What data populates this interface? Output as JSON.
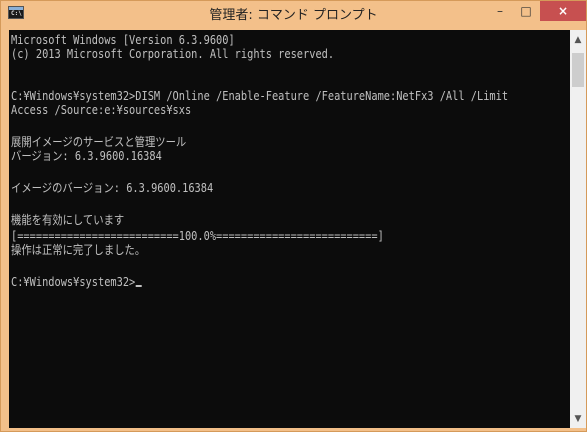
{
  "window": {
    "title": "管理者: コマンド プロンプト",
    "icon_label": "C:\\",
    "controls": {
      "minimize": "–",
      "maximize": "□",
      "close": "×"
    }
  },
  "console": {
    "lines": [
      "Microsoft Windows [Version 6.3.9600]",
      "(c) 2013 Microsoft Corporation. All rights reserved.",
      "",
      "C:¥Windows¥system32>DISM /Online /Enable-Feature /FeatureName:NetFx3 /All /Limit",
      "Access /Source:e:¥sources¥sxs",
      "",
      "展開イメージのサービスと管理ツール",
      "バージョン: 6.3.9600.16384",
      "",
      "イメージのバージョン: 6.3.9600.16384",
      "",
      "機能を有効にしています",
      "[==========================100.0%==========================]",
      "操作は正常に完了しました。",
      "",
      "C:¥Windows¥system32>"
    ]
  },
  "scrollbar": {
    "up_arrow": "▲",
    "down_arrow": "▼"
  },
  "colors": {
    "titlebar": "#f3c08a",
    "console_bg": "#0c0c0c",
    "console_fg": "#c0c0c0",
    "close": "#c75050"
  }
}
